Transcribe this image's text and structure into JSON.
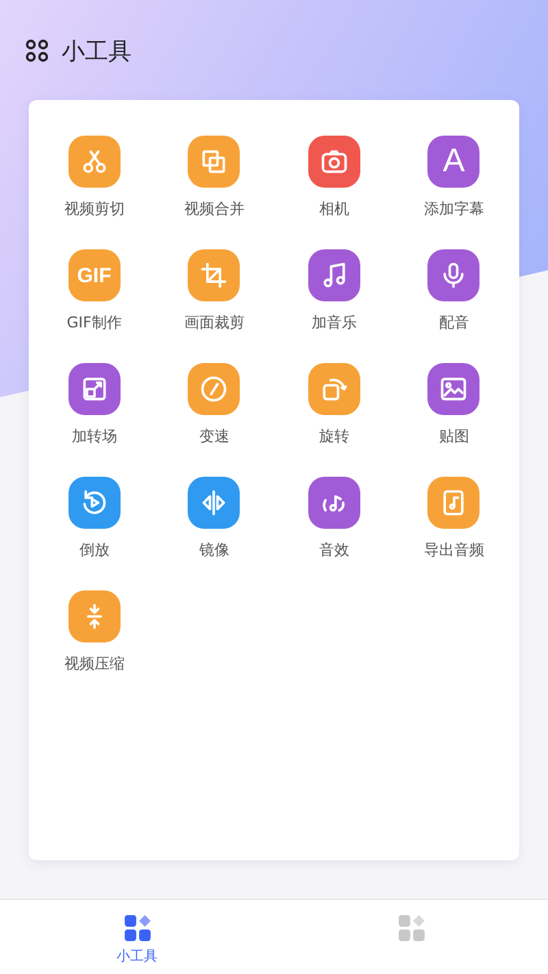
{
  "header": {
    "title": "小工具"
  },
  "tools": [
    {
      "label": "视频剪切",
      "kind": "scissors",
      "color": "#f7a238"
    },
    {
      "label": "视频合并",
      "kind": "merge",
      "color": "#f7a238"
    },
    {
      "label": "相机",
      "kind": "camera",
      "color": "#f0584f"
    },
    {
      "label": "添加字幕",
      "kind": "letter",
      "glyph": "A",
      "color": "#a25bd6"
    },
    {
      "label": "GIF制作",
      "kind": "letter",
      "glyph": "GIF",
      "color": "#f7a238"
    },
    {
      "label": "画面裁剪",
      "kind": "crop",
      "color": "#f7a238"
    },
    {
      "label": "加音乐",
      "kind": "music",
      "color": "#a25bd6"
    },
    {
      "label": "配音",
      "kind": "mic",
      "color": "#a25bd6"
    },
    {
      "label": "加转场",
      "kind": "transition",
      "color": "#a25bd6"
    },
    {
      "label": "变速",
      "kind": "speed",
      "color": "#f7a238"
    },
    {
      "label": "旋转",
      "kind": "rotate",
      "color": "#f7a238"
    },
    {
      "label": "贴图",
      "kind": "image",
      "color": "#a25bd6"
    },
    {
      "label": "倒放",
      "kind": "reverse",
      "color": "#2f9af0"
    },
    {
      "label": "镜像",
      "kind": "mirror",
      "color": "#2f9af0"
    },
    {
      "label": "音效",
      "kind": "sound",
      "color": "#a25bd6"
    },
    {
      "label": "导出音频",
      "kind": "export",
      "color": "#f7a238"
    },
    {
      "label": "视频压缩",
      "kind": "compress",
      "color": "#f7a238"
    }
  ],
  "tabs": [
    {
      "label": "小工具",
      "selected": true
    },
    {
      "selected": false
    }
  ]
}
